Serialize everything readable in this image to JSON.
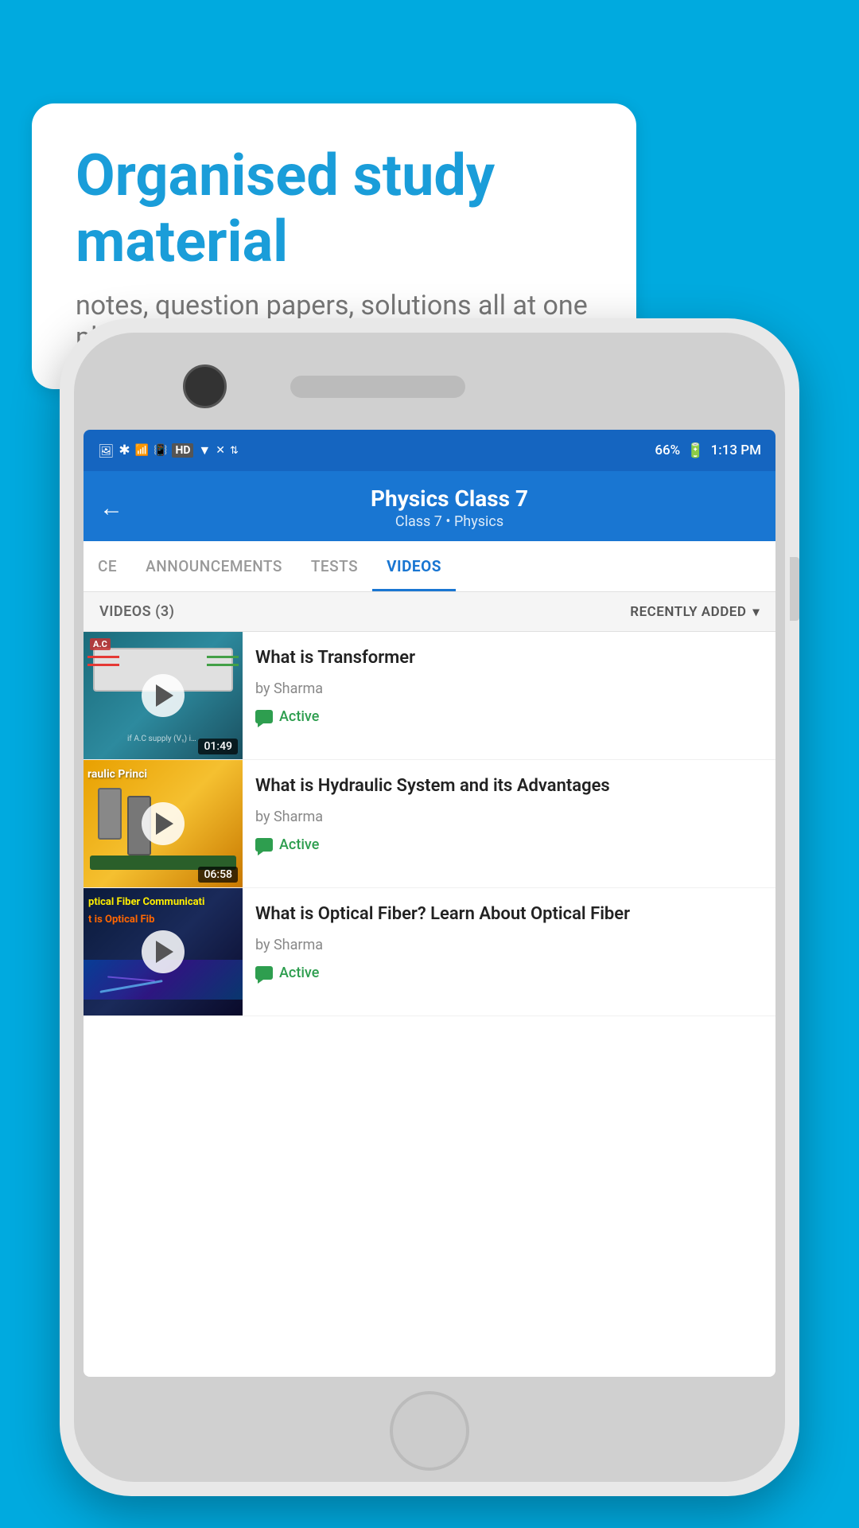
{
  "background_color": "#00aadf",
  "bubble": {
    "title": "Organised study material",
    "subtitle": "notes, question papers, solutions all at one place"
  },
  "status_bar": {
    "time": "1:13 PM",
    "battery": "66%",
    "signals": "HD"
  },
  "app_bar": {
    "title": "Physics Class 7",
    "subtitle_part1": "Class 7",
    "subtitle_separator": "   ",
    "subtitle_part2": "Physics",
    "back_label": "←"
  },
  "tabs": [
    {
      "id": "ce",
      "label": "CE",
      "active": false
    },
    {
      "id": "announcements",
      "label": "ANNOUNCEMENTS",
      "active": false
    },
    {
      "id": "tests",
      "label": "TESTS",
      "active": false
    },
    {
      "id": "videos",
      "label": "VIDEOS",
      "active": true
    }
  ],
  "filter_bar": {
    "videos_count": "VIDEOS (3)",
    "sort_label": "RECENTLY ADDED"
  },
  "videos": [
    {
      "id": "v1",
      "title": "What is  Transformer",
      "author": "by Sharma",
      "status": "Active",
      "duration": "01:49",
      "thumb_type": "transformer"
    },
    {
      "id": "v2",
      "title": "What is Hydraulic System and its Advantages",
      "author": "by Sharma",
      "status": "Active",
      "duration": "06:58",
      "thumb_type": "hydraulic",
      "thumb_label": "raulic Princi"
    },
    {
      "id": "v3",
      "title": "What is Optical Fiber? Learn About Optical Fiber",
      "author": "by Sharma",
      "status": "Active",
      "duration": "",
      "thumb_type": "optical",
      "thumb_label": "ptical Fiber Communicati",
      "thumb_sublabel": "t is Optical Fib"
    }
  ],
  "icons": {
    "play": "▶",
    "back": "←",
    "chevron_down": "▾",
    "chat": "💬"
  }
}
